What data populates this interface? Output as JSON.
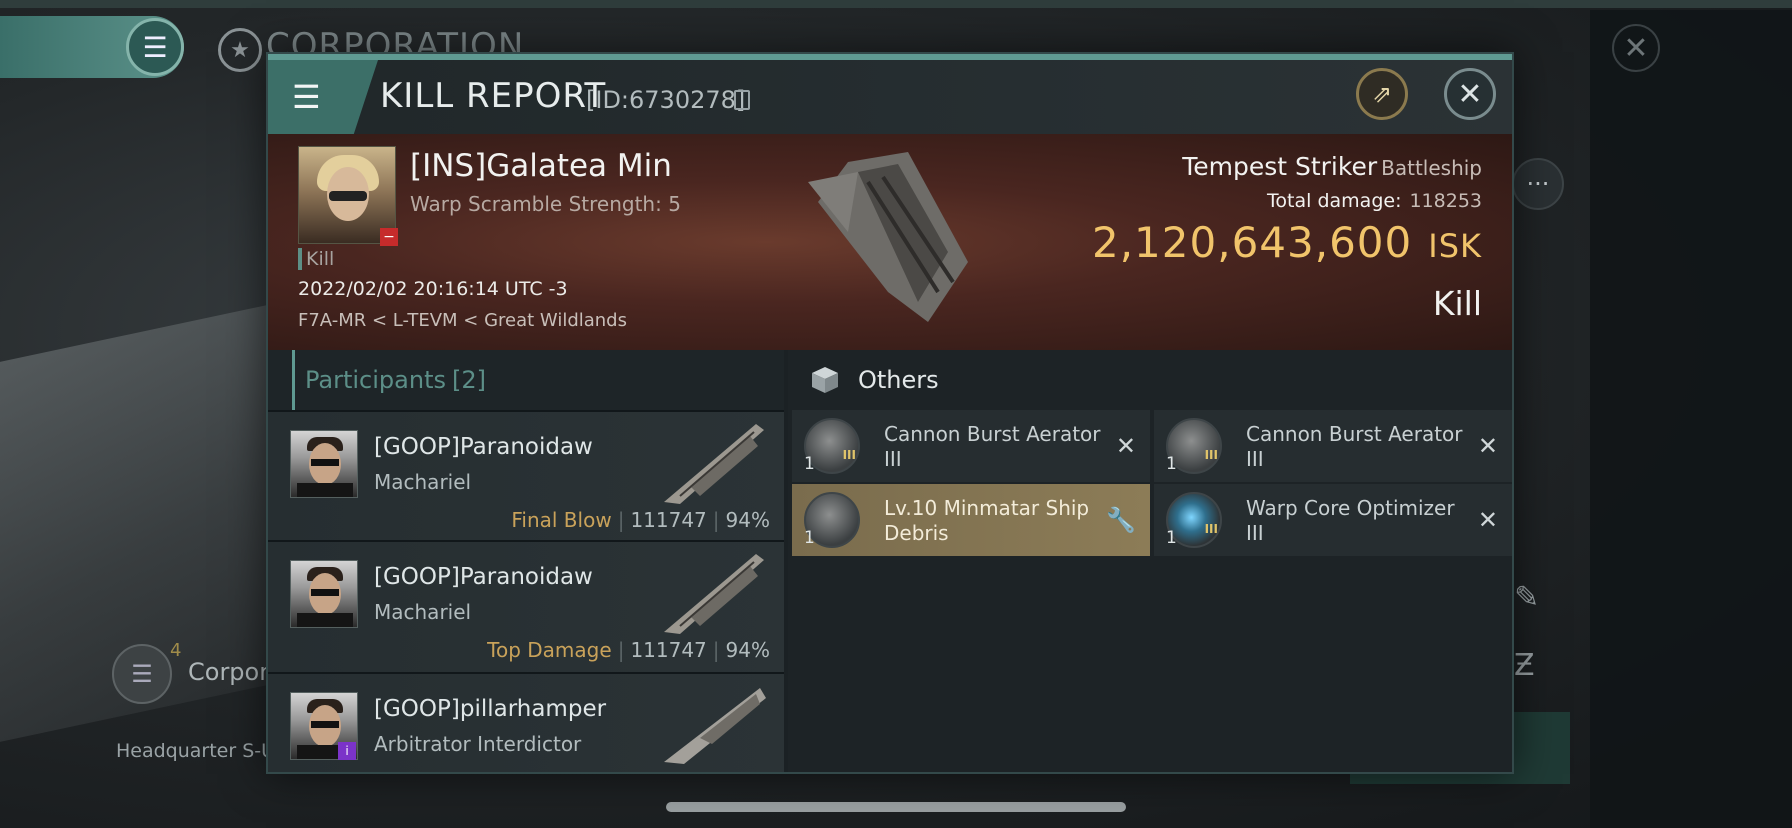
{
  "background": {
    "title": "CORPORATION",
    "corp_label": "Corpora",
    "corp_count": "4",
    "hq_label": "Headquarter S-U"
  },
  "dialog": {
    "title": "KILL REPORT",
    "id_label": "[ID:6730278]"
  },
  "victim": {
    "name": "[INS]Galatea Min",
    "subtitle": "Warp Scramble Strength: 5",
    "tag": "Kill",
    "time": "2022/02/02 20:16:14 UTC -3",
    "location": "F7A-MR < L-TEVM < Great Wildlands",
    "ship_name": "Tempest Striker",
    "ship_class": "Battleship",
    "total_damage_label": "Total damage:",
    "total_damage": "118253",
    "isk_value": "2,120,643,600",
    "isk_unit": "ISK",
    "result": "Kill"
  },
  "participants": {
    "label": "Participants",
    "count": "[2]",
    "rows": [
      {
        "name": "[GOOP]Paranoidaw",
        "ship": "Machariel",
        "role": "Final Blow",
        "damage": "111747",
        "percent": "94%"
      },
      {
        "name": "[GOOP]Paranoidaw",
        "ship": "Machariel",
        "role": "Top Damage",
        "damage": "111747",
        "percent": "94%"
      },
      {
        "name": "[GOOP]pillarhamper",
        "ship": "Arbitrator Interdictor"
      }
    ]
  },
  "others": {
    "label": "Others",
    "items": [
      {
        "qty": "1",
        "name": "Cannon Burst Aerator III",
        "icon": "cannon-burst-aerator-icon",
        "action": "close-icon"
      },
      {
        "qty": "1",
        "name": "Cannon Burst Aerator III",
        "icon": "cannon-burst-aerator-icon",
        "action": "close-icon"
      },
      {
        "qty": "1",
        "name": "Lv.10 Minmatar Ship Debris",
        "icon": "ship-debris-icon",
        "action": "wrench-icon"
      },
      {
        "qty": "1",
        "name": "Warp Core Optimizer III",
        "icon": "warp-core-optimizer-icon",
        "action": "close-icon"
      }
    ]
  },
  "colors": {
    "accent": "#5f9a92",
    "isk": "#f1c46b",
    "role": "#c9a25a",
    "selected": "#8c7c57"
  }
}
